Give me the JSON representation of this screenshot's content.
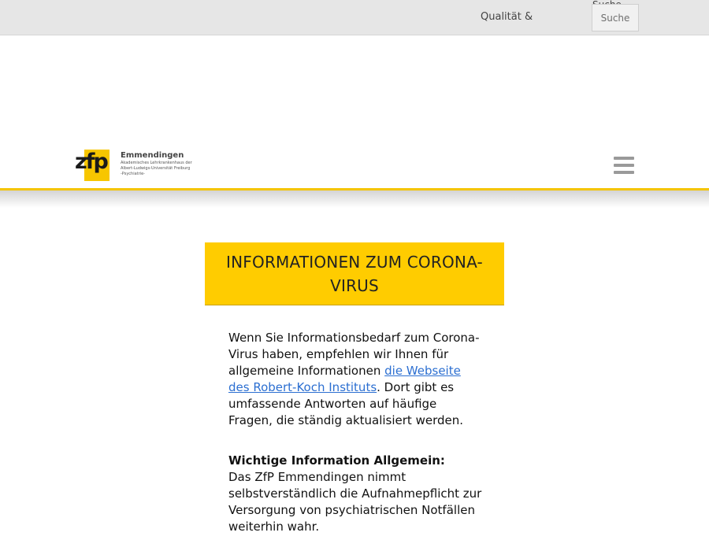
{
  "topbar": {
    "nav_link": "Qualität &",
    "search_label": "Suche",
    "search_button": "Suche"
  },
  "header": {
    "logo": {
      "mark": "zfp",
      "name": "Emmendingen",
      "subtitle_1": "Akademisches Lehrkrankenhaus der",
      "subtitle_2": "Albert-Ludwigs-Universität Freiburg",
      "subtitle_3": "-Psychiatrie-"
    },
    "menu_icon": "hamburger-menu-icon"
  },
  "article": {
    "title": "INFORMATIONEN ZUM CORONA-VIRUS",
    "intro_before_link": "Wenn Sie Informationsbedarf zum Corona-Virus haben, empfehlen wir Ihnen für allgemeine Informationen ",
    "intro_link": "die Webseite des Robert-Koch Instituts",
    "intro_after_link": ". Dort gibt es umfassende Antworten auf häufige Fragen, die ständig aktualisiert werden.",
    "section_heading": "Wichtige Information Allgemein:",
    "section_text": "Das ZfP Emmendingen nimmt selbstverständlich die Aufnahmepflicht zur Versorgung von psychiatrischen Notfällen weiterhin wahr."
  },
  "colors": {
    "accent_yellow": "#ffcc00",
    "link_blue": "#2c6fd1",
    "topbar_gray": "#e6e6e6"
  }
}
